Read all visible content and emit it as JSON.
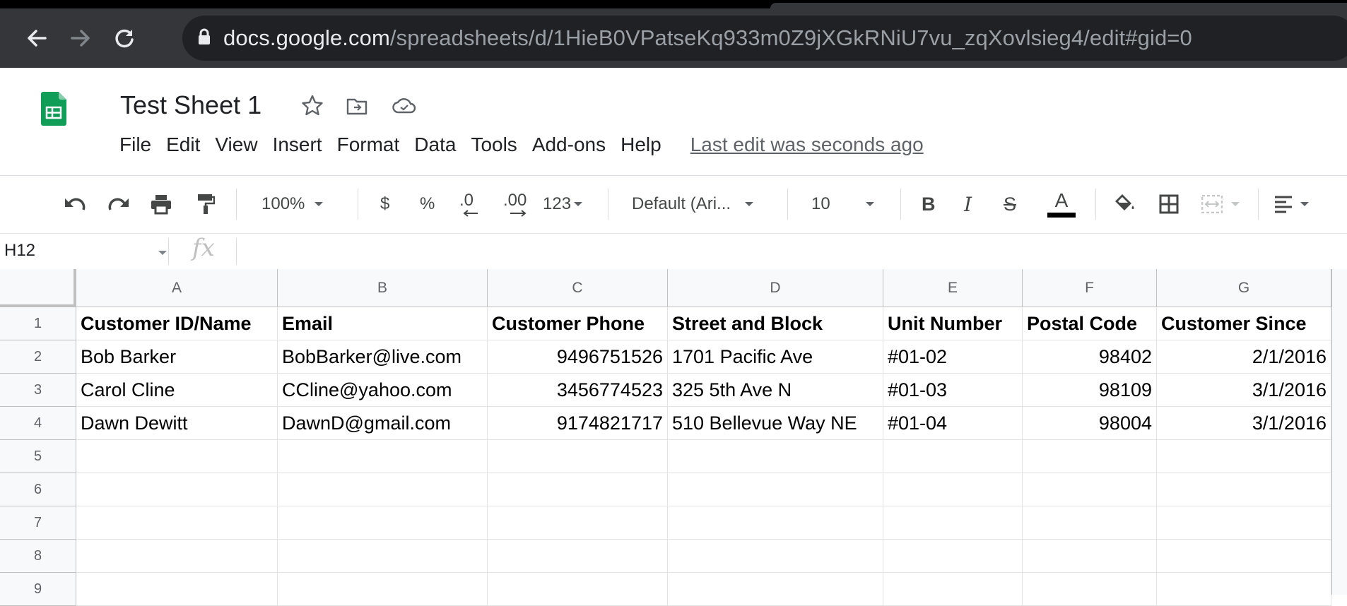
{
  "browser": {
    "url_domain": "docs.google.com",
    "url_path": "/spreadsheets/d/1HieB0VPatseKq933m0Z9jXGkRNiU7vu_zqXovlsieg4/edit#gid=0"
  },
  "doc": {
    "title": "Test Sheet 1",
    "menu": [
      "File",
      "Edit",
      "View",
      "Insert",
      "Format",
      "Data",
      "Tools",
      "Add-ons",
      "Help"
    ],
    "last_edit": "Last edit was seconds ago"
  },
  "toolbar": {
    "zoom": "100%",
    "currency": "$",
    "percent": "%",
    "decrease_decimal": ".0",
    "increase_decimal": ".00",
    "more_formats": "123",
    "font": "Default (Ari...",
    "font_size": "10",
    "bold": "B",
    "italic": "I",
    "strikethrough": "S",
    "text_color": "A",
    "text_color_value": "#000000"
  },
  "formula_bar": {
    "name_box": "H12",
    "fx": "fx",
    "content": ""
  },
  "sheet": {
    "columns": [
      "A",
      "B",
      "C",
      "D",
      "E",
      "F",
      "G"
    ],
    "row_numbers": [
      "1",
      "2",
      "3",
      "4",
      "5",
      "6",
      "7",
      "8",
      "9"
    ],
    "header": [
      "Customer ID/Name",
      "Email",
      "Customer Phone",
      "Street and Block",
      "Unit Number",
      "Postal Code",
      "Customer Since"
    ],
    "rows": [
      [
        "Bob Barker",
        "BobBarker@live.com",
        "9496751526",
        "1701 Pacific Ave",
        "#01-02",
        "98402",
        "2/1/2016"
      ],
      [
        "Carol Cline",
        "CCline@yahoo.com",
        "3456774523",
        "325 5th Ave N",
        "#01-03",
        "98109",
        "3/1/2016"
      ],
      [
        "Dawn Dewitt",
        "DawnD@gmail.com",
        "9174821717",
        "510 Bellevue Way NE",
        "#01-04",
        "98004",
        "3/1/2016"
      ]
    ]
  },
  "colors": {
    "chrome_bg": "#35363a",
    "omnibox_bg": "#202124",
    "sheets_green": "#0f9d58",
    "grid_line": "#e2e3e3",
    "header_bg": "#f8f9fa"
  }
}
